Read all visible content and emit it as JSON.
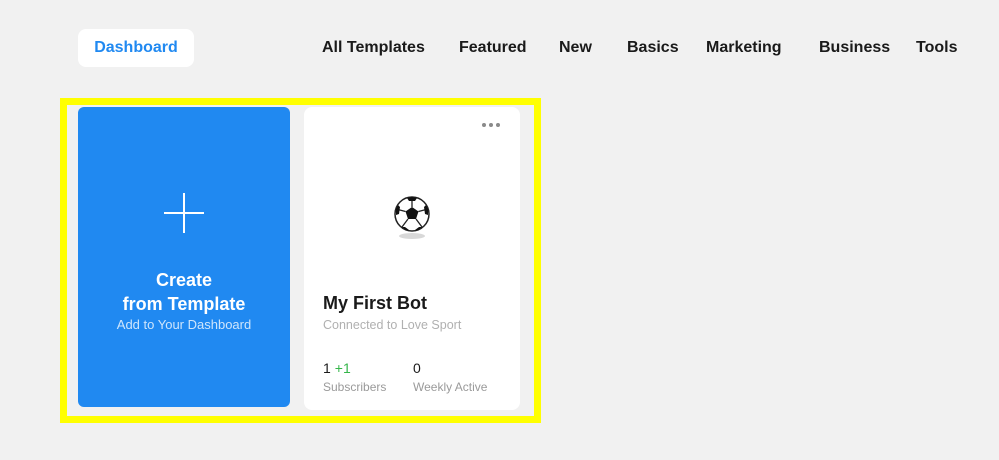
{
  "nav": {
    "dashboard_label": "Dashboard",
    "tabs": [
      {
        "label": "All Templates"
      },
      {
        "label": "Featured"
      },
      {
        "label": "New"
      },
      {
        "label": "Basics"
      },
      {
        "label": "Marketing"
      },
      {
        "label": "Business"
      },
      {
        "label": "Tools"
      }
    ]
  },
  "create_card": {
    "title_line1": "Create",
    "title_line2": "from Template",
    "subtitle": "Add to Your Dashboard",
    "icon": "plus-icon"
  },
  "bot_card": {
    "name": "My First Bot",
    "connected_to": "Connected to Love Sport",
    "avatar_icon": "soccer-ball-icon",
    "menu_icon": "more-horizontal-icon",
    "stats": {
      "subscribers": {
        "value": "1",
        "delta": "+1",
        "label": "Subscribers"
      },
      "weekly_active": {
        "value": "0",
        "label": "Weekly Active"
      }
    }
  },
  "colors": {
    "accent": "#2089f1",
    "highlight": "#ffff00",
    "positive": "#35b64a",
    "background": "#f1f1f1"
  }
}
